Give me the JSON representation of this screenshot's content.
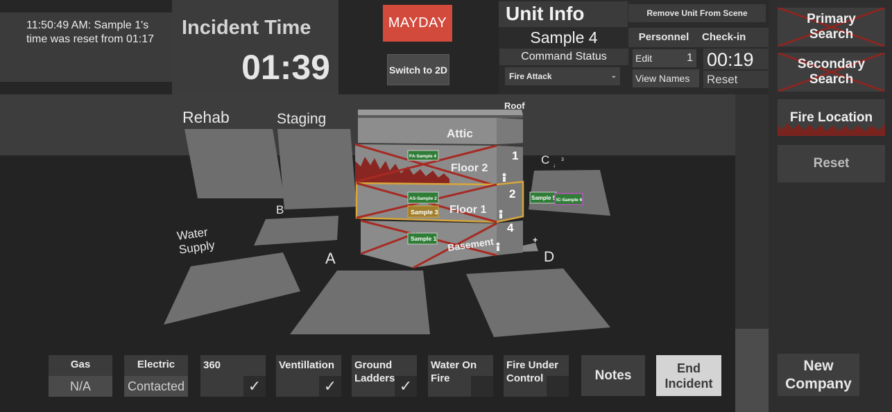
{
  "log": {
    "message": "11:50:49 AM: Sample 1's time was reset from 01:17"
  },
  "incident": {
    "title": "Incident Time",
    "time": "01:39"
  },
  "mayday": {
    "label": "MAYDAY",
    "color": "#d24a3c"
  },
  "view": {
    "switch_label": "Switch to 2D"
  },
  "unit": {
    "title": "Unit Info",
    "remove_label": "Remove Unit From Scene",
    "name": "Sample 4",
    "command_status_label": "Command Status",
    "command_status_value": "Fire Attack",
    "personnel_label": "Personnel",
    "checkin_label": "Check-in",
    "edit_label": "Edit",
    "personnel_count": "1",
    "view_names_label": "View Names",
    "checkin_time": "00:19",
    "reset_label": "Reset"
  },
  "right_panel": {
    "primary_search": [
      "Primary",
      "Search"
    ],
    "secondary_search": [
      "Secondary",
      "Search"
    ],
    "fire_location": "Fire Location",
    "reset": "Reset",
    "new_company": [
      "New",
      "Company"
    ]
  },
  "scene": {
    "zones": {
      "rehab": "Rehab",
      "staging": "Staging",
      "water_supply": [
        "Water",
        "Supply"
      ],
      "side_a": "A",
      "side_b": "B",
      "side_c": "C",
      "side_d": "D"
    },
    "building": {
      "roof": "Roof",
      "floors": [
        {
          "name": "Attic",
          "count": ""
        },
        {
          "name": "Floor 2",
          "count": "1",
          "units": [
            "FA-Sample 4"
          ]
        },
        {
          "name": "Floor 1",
          "count": "2",
          "units": [
            "AS-Sample 2",
            "Sample 3"
          ]
        },
        {
          "name": "Basement",
          "count": "4",
          "units": [
            "Sample 1"
          ]
        }
      ]
    },
    "side_c_units": [
      "Sample 5",
      "IC-Sample 6"
    ],
    "side_c_count": "3"
  },
  "toolbar": {
    "gas": {
      "label": "Gas",
      "value": "N/A"
    },
    "electric": {
      "label": "Electric",
      "value": "Contacted"
    },
    "t360": {
      "label": "360",
      "checked": true
    },
    "ventilation": {
      "label": "Ventillation",
      "checked": true
    },
    "ground_ladders": {
      "label": "Ground Ladders",
      "checked": true
    },
    "water_on_fire": {
      "label": "Water On Fire",
      "checked": false
    },
    "fire_under_control": {
      "label": "Fire Under Control",
      "checked": false
    },
    "notes": "Notes",
    "end_incident": [
      "End",
      "Incident"
    ]
  },
  "colors": {
    "unit_green": "#2f7d36",
    "highlight": "#d9a63a",
    "fire_red": "#a12a24"
  }
}
